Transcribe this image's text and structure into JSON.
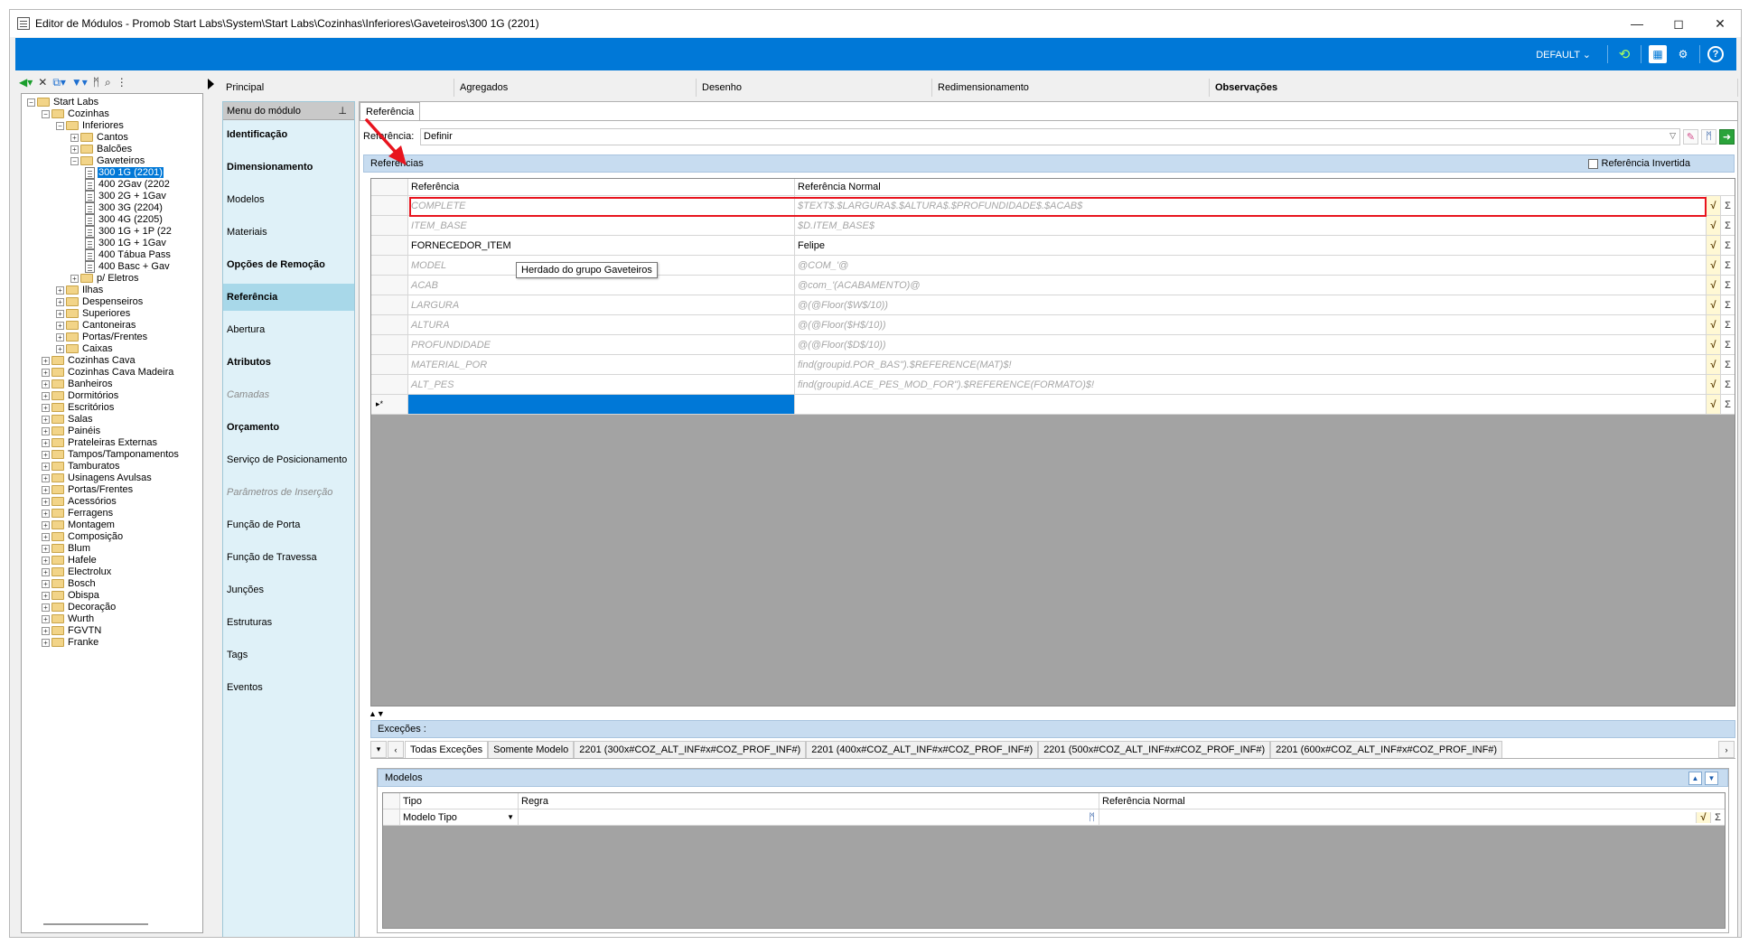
{
  "window": {
    "title": "Editor de Módulos - Promob Start Labs\\System\\Start Labs\\Cozinhas\\Inferiores\\Gaveteiros\\300 1G (2201)",
    "minimize": "—",
    "maximize": "◻",
    "close": "✕"
  },
  "ribbon": {
    "profile": "DEFAULT ⌄",
    "icons": [
      "refresh-icon",
      "catalog-icon",
      "settings-icon",
      "help-icon"
    ]
  },
  "tree": {
    "items": [
      {
        "label": "Start Labs",
        "depth": 0,
        "type": "folder",
        "expanded": true
      },
      {
        "label": "Cozinhas",
        "depth": 1,
        "type": "folder",
        "expanded": true
      },
      {
        "label": "Inferiores",
        "depth": 2,
        "type": "folder",
        "expanded": true
      },
      {
        "label": "Cantos",
        "depth": 3,
        "type": "folder",
        "expanded": false
      },
      {
        "label": "Balcões",
        "depth": 3,
        "type": "folder",
        "expanded": false
      },
      {
        "label": "Gaveteiros",
        "depth": 3,
        "type": "folder",
        "expanded": true
      },
      {
        "label": "300 1G (2201)",
        "depth": 4,
        "type": "doc",
        "selected": true
      },
      {
        "label": "400 2Gav (2202",
        "depth": 4,
        "type": "doc"
      },
      {
        "label": "300 2G + 1Gav",
        "depth": 4,
        "type": "doc"
      },
      {
        "label": "300 3G (2204)",
        "depth": 4,
        "type": "doc"
      },
      {
        "label": "300 4G (2205)",
        "depth": 4,
        "type": "doc"
      },
      {
        "label": "300 1G + 1P (22",
        "depth": 4,
        "type": "doc"
      },
      {
        "label": "300 1G + 1Gav",
        "depth": 4,
        "type": "doc"
      },
      {
        "label": "400 Tábua Pass",
        "depth": 4,
        "type": "doc"
      },
      {
        "label": "400 Basc + Gav",
        "depth": 4,
        "type": "doc"
      },
      {
        "label": "p/ Eletros",
        "depth": 3,
        "type": "folder",
        "expanded": false
      },
      {
        "label": "Ilhas",
        "depth": 2,
        "type": "folder",
        "expanded": false
      },
      {
        "label": "Despenseiros",
        "depth": 2,
        "type": "folder",
        "expanded": false
      },
      {
        "label": "Superiores",
        "depth": 2,
        "type": "folder",
        "expanded": false
      },
      {
        "label": "Cantoneiras",
        "depth": 2,
        "type": "folder",
        "expanded": false
      },
      {
        "label": "Portas/Frentes",
        "depth": 2,
        "type": "folder",
        "expanded": false
      },
      {
        "label": "Caixas",
        "depth": 2,
        "type": "folder",
        "expanded": false
      },
      {
        "label": "Cozinhas Cava",
        "depth": 1,
        "type": "folder",
        "expanded": false
      },
      {
        "label": "Cozinhas Cava Madeira",
        "depth": 1,
        "type": "folder",
        "expanded": false
      },
      {
        "label": "Banheiros",
        "depth": 1,
        "type": "folder",
        "expanded": false
      },
      {
        "label": "Dormitórios",
        "depth": 1,
        "type": "folder",
        "expanded": false
      },
      {
        "label": "Escritórios",
        "depth": 1,
        "type": "folder",
        "expanded": false
      },
      {
        "label": "Salas",
        "depth": 1,
        "type": "folder",
        "expanded": false
      },
      {
        "label": "Painéis",
        "depth": 1,
        "type": "folder",
        "expanded": false
      },
      {
        "label": "Prateleiras Externas",
        "depth": 1,
        "type": "folder",
        "expanded": false
      },
      {
        "label": "Tampos/Tamponamentos",
        "depth": 1,
        "type": "folder",
        "expanded": false
      },
      {
        "label": "Tamburatos",
        "depth": 1,
        "type": "folder",
        "expanded": false
      },
      {
        "label": "Usinagens Avulsas",
        "depth": 1,
        "type": "folder",
        "expanded": false
      },
      {
        "label": "Portas/Frentes",
        "depth": 1,
        "type": "folder",
        "expanded": false
      },
      {
        "label": "Acessórios",
        "depth": 1,
        "type": "folder",
        "expanded": false
      },
      {
        "label": "Ferragens",
        "depth": 1,
        "type": "folder",
        "expanded": false
      },
      {
        "label": "Montagem",
        "depth": 1,
        "type": "folder",
        "expanded": false
      },
      {
        "label": "Composição",
        "depth": 1,
        "type": "folder",
        "expanded": false
      },
      {
        "label": "Blum",
        "depth": 1,
        "type": "folder",
        "expanded": false
      },
      {
        "label": "Hafele",
        "depth": 1,
        "type": "folder",
        "expanded": false
      },
      {
        "label": "Electrolux",
        "depth": 1,
        "type": "folder",
        "expanded": false
      },
      {
        "label": "Bosch",
        "depth": 1,
        "type": "folder",
        "expanded": false
      },
      {
        "label": "Obispa",
        "depth": 1,
        "type": "folder",
        "expanded": false
      },
      {
        "label": "Decoração",
        "depth": 1,
        "type": "folder",
        "expanded": false
      },
      {
        "label": "Wurth",
        "depth": 1,
        "type": "folder",
        "expanded": false
      },
      {
        "label": "FGVTN",
        "depth": 1,
        "type": "folder",
        "expanded": false
      },
      {
        "label": "Franke",
        "depth": 1,
        "type": "folder",
        "expanded": false
      }
    ]
  },
  "main_tabs": [
    {
      "label": "Principal",
      "bold": false
    },
    {
      "label": "Agregados",
      "bold": false
    },
    {
      "label": "Desenho",
      "bold": false
    },
    {
      "label": "Redimensionamento",
      "bold": false
    },
    {
      "label": "Observações",
      "bold": true
    }
  ],
  "menu": {
    "header": "Menu do módulo",
    "pin": "⊥",
    "items": [
      {
        "label": "Identificação",
        "style": "bold"
      },
      {
        "label": "Dimensionamento",
        "style": "bold"
      },
      {
        "label": "Modelos",
        "style": "normal"
      },
      {
        "label": "Materiais",
        "style": "normal"
      },
      {
        "label": "Opções de Remoção",
        "style": "bold"
      },
      {
        "label": "Referência",
        "style": "bold",
        "active": true
      },
      {
        "label": "Abertura",
        "style": "normal"
      },
      {
        "label": "Atributos",
        "style": "bold"
      },
      {
        "label": "Camadas",
        "style": "disabled"
      },
      {
        "label": "Orçamento",
        "style": "bold"
      },
      {
        "label": "Serviço de Posicionamento",
        "style": "normal"
      },
      {
        "label": "Parâmetros de Inserção",
        "style": "disabled"
      },
      {
        "label": "Função de Porta",
        "style": "normal"
      },
      {
        "label": "Função de Travessa",
        "style": "normal"
      },
      {
        "label": "Junções",
        "style": "normal"
      },
      {
        "label": "Estruturas",
        "style": "normal"
      },
      {
        "label": "Tags",
        "style": "normal"
      },
      {
        "label": "Eventos",
        "style": "normal"
      }
    ]
  },
  "content": {
    "tab": "Referência",
    "reference_label": "Referência:",
    "reference_value": "Definir",
    "references_header": "Referências",
    "inverted_label": "Referência Invertida",
    "columns": {
      "ref": "Referência",
      "normal": "Referência Normal"
    },
    "rows": [
      {
        "ref": "COMPLETE",
        "normal": "$TEXT$.$LARGURA$.$ALTURA$.$PROFUNDIDADE$.$ACAB$",
        "inherited": true
      },
      {
        "ref": "ITEM_BASE",
        "normal": "$D.ITEM_BASE$",
        "inherited": true
      },
      {
        "ref": "FORNECEDOR_ITEM",
        "normal": "Felipe",
        "inherited": false
      },
      {
        "ref": "MODEL",
        "normal": "@COM_'@",
        "inherited": true
      },
      {
        "ref": "ACAB",
        "normal": "@com_'(ACABAMENTO)@",
        "inherited": true
      },
      {
        "ref": "LARGURA",
        "normal": "@(@Floor($W$/10))",
        "inherited": true
      },
      {
        "ref": "ALTURA",
        "normal": "@(@Floor($H$/10))",
        "inherited": true
      },
      {
        "ref": "PROFUNDIDADE",
        "normal": "@(@Floor($D$/10))",
        "inherited": true
      },
      {
        "ref": "MATERIAL_POR",
        "normal": "find(groupid.POR_BAS\").$REFERENCE(MAT)$!",
        "inherited": true
      },
      {
        "ref": "ALT_PES",
        "normal": "find(groupid.ACE_PES_MOD_FOR\").$REFERENCE(FORMATO)$!",
        "inherited": true
      }
    ],
    "new_row_marker": "▸*",
    "tooltip": "Herdado do grupo Gaveteiros",
    "btn_sqrt": "√",
    "btn_sigma": "Σ"
  },
  "exceptions": {
    "header": "Exceções :",
    "tabs": [
      "Todas Exceções",
      "Somente Modelo",
      "2201 (300x#COZ_ALT_INF#x#COZ_PROF_INF#)",
      "2201 (400x#COZ_ALT_INF#x#COZ_PROF_INF#)",
      "2201 (500x#COZ_ALT_INF#x#COZ_PROF_INF#)",
      "2201 (600x#COZ_ALT_INF#x#COZ_PROF_INF#)"
    ],
    "models_header": "Modelos",
    "model_columns": {
      "tipo": "Tipo",
      "regra": "Regra",
      "normal": "Referência Normal"
    },
    "model_row": {
      "tipo": "Modelo Tipo",
      "regra": "",
      "normal": ""
    }
  }
}
